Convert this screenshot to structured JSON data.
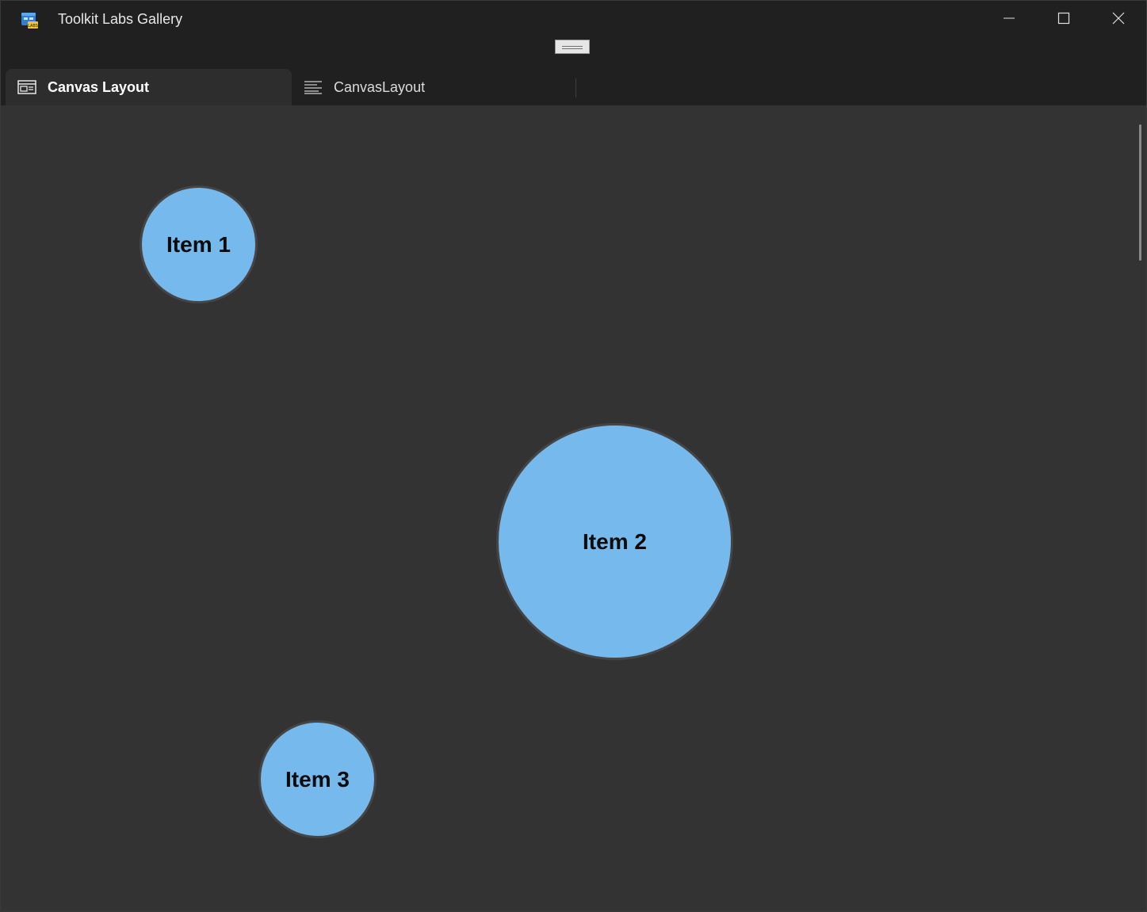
{
  "window": {
    "title": "Toolkit Labs Gallery",
    "app_icon": "toolkit-labs-icon",
    "app_icon_badge": "LABS",
    "controls": {
      "minimize_icon": "minimize-icon",
      "maximize_icon": "maximize-icon",
      "close_icon": "close-icon"
    }
  },
  "tabs": [
    {
      "label": "Canvas Layout",
      "icon": "sample-window-icon",
      "active": true
    },
    {
      "label": "CanvasLayout",
      "icon": "document-lines-icon",
      "active": false
    }
  ],
  "canvas": {
    "background": "#333333",
    "item_color": "#76b9ed",
    "items": [
      {
        "label": "Item 1"
      },
      {
        "label": "Item 2"
      },
      {
        "label": "Item 3"
      }
    ]
  }
}
